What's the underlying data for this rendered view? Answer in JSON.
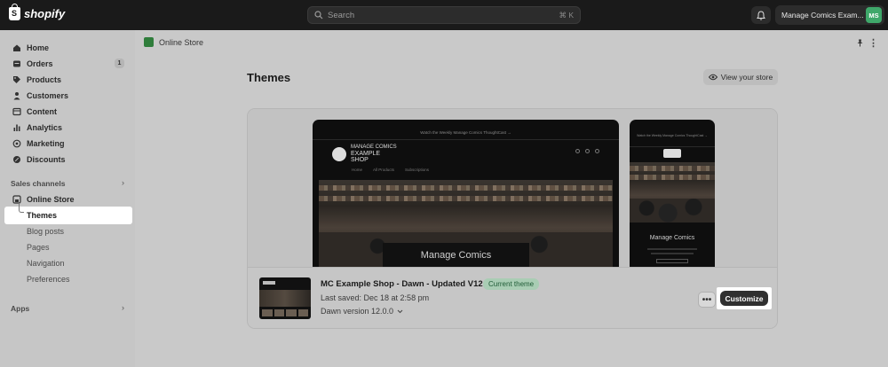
{
  "topbar": {
    "logo_text": "shopify",
    "search_placeholder": "Search",
    "search_shortcut": "⌘ K",
    "store_name": "Manage Comics Exam...",
    "avatar_initials": "MS"
  },
  "sidebar": {
    "items": [
      {
        "label": "Home",
        "icon": "home-icon"
      },
      {
        "label": "Orders",
        "icon": "orders-icon",
        "badge": "1"
      },
      {
        "label": "Products",
        "icon": "tag-icon"
      },
      {
        "label": "Customers",
        "icon": "person-icon"
      },
      {
        "label": "Content",
        "icon": "content-icon"
      },
      {
        "label": "Analytics",
        "icon": "bar-chart-icon"
      },
      {
        "label": "Marketing",
        "icon": "target-icon"
      },
      {
        "label": "Discounts",
        "icon": "discount-icon"
      }
    ],
    "sales_channels_label": "Sales channels",
    "online_store_label": "Online Store",
    "sub_items": [
      "Themes",
      "Blog posts",
      "Pages",
      "Navigation",
      "Preferences"
    ],
    "apps_label": "Apps"
  },
  "main": {
    "breadcrumb": "Online Store",
    "page_title": "Themes",
    "view_store_label": "View your store",
    "preview": {
      "desktop_title": "Manage Comics",
      "mobile_title": "Manage Comics",
      "announcement": "Watch the Weekly Manage Comics ThoughtCast →",
      "logo_line1": "MANAGE COMICS",
      "logo_line2": "EXAMPLE",
      "logo_line3": "SHOP",
      "nav": [
        "Home",
        "All Products",
        "Subscriptions"
      ]
    },
    "theme": {
      "name": "MC Example Shop - Dawn - Updated V12",
      "status_badge": "Current theme",
      "last_saved": "Last saved: Dec 18 at 2:58 pm",
      "version": "Dawn version 12.0.0",
      "customize_label": "Customize",
      "more_label": "•••"
    }
  },
  "colors": {
    "topbar": "#1a1a1a",
    "avatar": "#3fa86a",
    "badge_bg": "#a9cdb4",
    "customize_bg": "#303030"
  }
}
